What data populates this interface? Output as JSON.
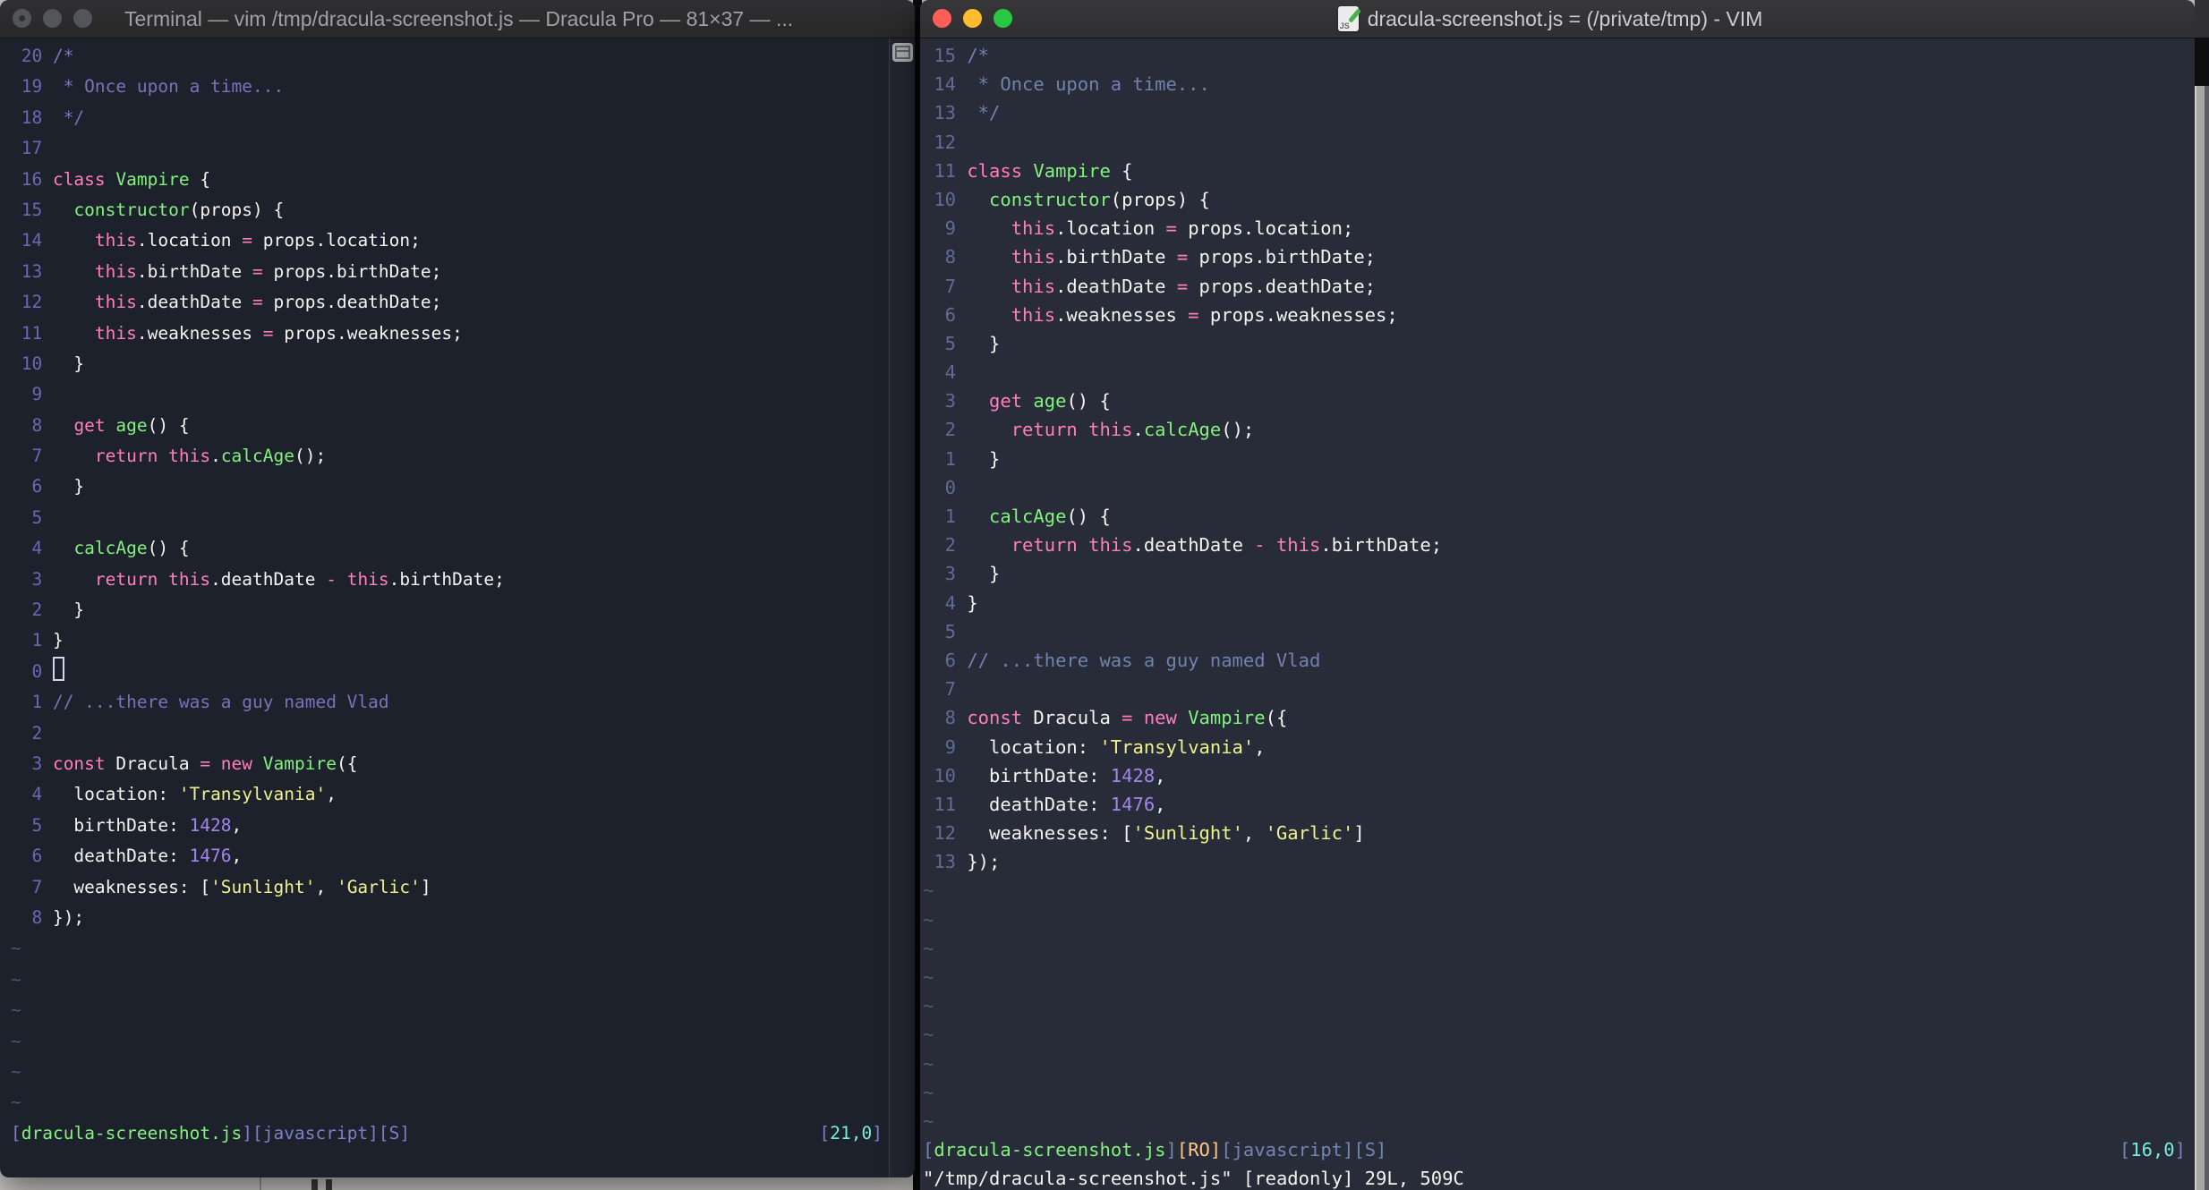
{
  "palette": {
    "bg_left": "#1d212b",
    "bg_right": "#272c38",
    "fg": "#f5f4f0",
    "pink": "#ff7ebe",
    "green": "#83f27e",
    "yellow": "#eff28d",
    "purple": "#a385f0",
    "cyan": "#76eedd",
    "orange": "#ffc987",
    "cursor": "#d9d3f2",
    "traffic_red": "#ff5f57",
    "traffic_yellow": "#febc2e",
    "traffic_green": "#28c840",
    "traffic_inactive": "#53555b"
  },
  "left": {
    "title": "Terminal — vim /tmp/dracula-screenshot.js — Dracula Pro — 81×37 — ...",
    "cursor_row": 20,
    "tilde_count": 6,
    "numbers": [
      "20",
      "19",
      "18",
      "17",
      "16",
      "15",
      "14",
      "13",
      "12",
      "11",
      "10",
      "9",
      "8",
      "7",
      "6",
      "5",
      "4",
      "3",
      "2",
      "1",
      "0",
      "1",
      "2",
      "3",
      "4",
      "5",
      "6",
      "7",
      "8"
    ],
    "status": [
      [
        "slate",
        "["
      ],
      [
        "green",
        "dracula-screenshot.js"
      ],
      [
        "slate",
        "][javascript][S]"
      ]
    ],
    "ruler": [
      [
        "slate",
        "["
      ],
      [
        "cyan",
        "21,0"
      ],
      [
        "slate",
        "]"
      ]
    ],
    "cmdline": "",
    "colors": {
      "comment": "#7b72b8",
      "ln": "#6d66b2",
      "slate": "#7a80c4",
      "tilde": "#564f78"
    }
  },
  "right": {
    "title": "dracula-screenshot.js = (/private/tmp) - VIM",
    "cursor_row": null,
    "tilde_count": 9,
    "numbers": [
      "15",
      "14",
      "13",
      "12",
      "11",
      "10",
      "9",
      "8",
      "7",
      "6",
      "5",
      "4",
      "3",
      "2",
      "1",
      "0",
      "1",
      "2",
      "3",
      "4",
      "5",
      "6",
      "7",
      "8",
      "9",
      "10",
      "11",
      "12",
      "13"
    ],
    "status": [
      [
        "slate",
        "["
      ],
      [
        "green",
        "dracula-screenshot.js"
      ],
      [
        "slate",
        "]"
      ],
      [
        "orange",
        "[RO]"
      ],
      [
        "slate",
        "[javascript][S]"
      ]
    ],
    "ruler": [
      [
        "slate",
        "["
      ],
      [
        "cyan",
        "16,0"
      ],
      [
        "slate",
        "]"
      ]
    ],
    "cmdline": "\"/tmp/dracula-screenshot.js\" [readonly] 29L, 509C",
    "colors": {
      "comment": "#7182ae",
      "ln": "#5f6c95",
      "slate": "#7285b3",
      "tilde": "#4e5977"
    }
  },
  "code_lines": [
    [
      [
        "comment",
        "/*"
      ]
    ],
    [
      [
        "comment",
        " * Once upon a time..."
      ]
    ],
    [
      [
        "comment",
        " */"
      ]
    ],
    [],
    [
      [
        "pink",
        "class "
      ],
      [
        "green",
        "Vampire "
      ],
      [
        "fg",
        "{"
      ]
    ],
    [
      [
        "fg",
        "  "
      ],
      [
        "green",
        "constructor"
      ],
      [
        "fg",
        "(props) {"
      ]
    ],
    [
      [
        "fg",
        "    "
      ],
      [
        "pink",
        "this"
      ],
      [
        "fg",
        ".location "
      ],
      [
        "pink",
        "="
      ],
      [
        "fg",
        " props.location;"
      ]
    ],
    [
      [
        "fg",
        "    "
      ],
      [
        "pink",
        "this"
      ],
      [
        "fg",
        ".birthDate "
      ],
      [
        "pink",
        "="
      ],
      [
        "fg",
        " props.birthDate;"
      ]
    ],
    [
      [
        "fg",
        "    "
      ],
      [
        "pink",
        "this"
      ],
      [
        "fg",
        ".deathDate "
      ],
      [
        "pink",
        "="
      ],
      [
        "fg",
        " props.deathDate;"
      ]
    ],
    [
      [
        "fg",
        "    "
      ],
      [
        "pink",
        "this"
      ],
      [
        "fg",
        ".weaknesses "
      ],
      [
        "pink",
        "="
      ],
      [
        "fg",
        " props.weaknesses;"
      ]
    ],
    [
      [
        "fg",
        "  }"
      ]
    ],
    [],
    [
      [
        "fg",
        "  "
      ],
      [
        "pink",
        "get "
      ],
      [
        "green",
        "age"
      ],
      [
        "fg",
        "() {"
      ]
    ],
    [
      [
        "fg",
        "    "
      ],
      [
        "pink",
        "return this"
      ],
      [
        "fg",
        "."
      ],
      [
        "green",
        "calcAge"
      ],
      [
        "fg",
        "();"
      ]
    ],
    [
      [
        "fg",
        "  }"
      ]
    ],
    [],
    [
      [
        "fg",
        "  "
      ],
      [
        "green",
        "calcAge"
      ],
      [
        "fg",
        "() {"
      ]
    ],
    [
      [
        "fg",
        "    "
      ],
      [
        "pink",
        "return this"
      ],
      [
        "fg",
        ".deathDate "
      ],
      [
        "pink",
        "-"
      ],
      [
        "fg",
        " "
      ],
      [
        "pink",
        "this"
      ],
      [
        "fg",
        ".birthDate;"
      ]
    ],
    [
      [
        "fg",
        "  }"
      ]
    ],
    [
      [
        "fg",
        "}"
      ]
    ],
    [],
    [
      [
        "comment",
        "// ...there was a guy named Vlad"
      ]
    ],
    [],
    [
      [
        "pink",
        "const "
      ],
      [
        "fg",
        "Dracula "
      ],
      [
        "pink",
        "= new "
      ],
      [
        "green",
        "Vampire"
      ],
      [
        "fg",
        "({"
      ]
    ],
    [
      [
        "fg",
        "  location: "
      ],
      [
        "yellow",
        "'Transylvania'"
      ],
      [
        "fg",
        ","
      ]
    ],
    [
      [
        "fg",
        "  birthDate: "
      ],
      [
        "purple",
        "1428"
      ],
      [
        "fg",
        ","
      ]
    ],
    [
      [
        "fg",
        "  deathDate: "
      ],
      [
        "purple",
        "1476"
      ],
      [
        "fg",
        ","
      ]
    ],
    [
      [
        "fg",
        "  weaknesses: ["
      ],
      [
        "yellow",
        "'Sunlight'"
      ],
      [
        "fg",
        ", "
      ],
      [
        "yellow",
        "'Garlic'"
      ],
      [
        "fg",
        "]"
      ]
    ],
    [
      [
        "fg",
        "});"
      ]
    ]
  ]
}
